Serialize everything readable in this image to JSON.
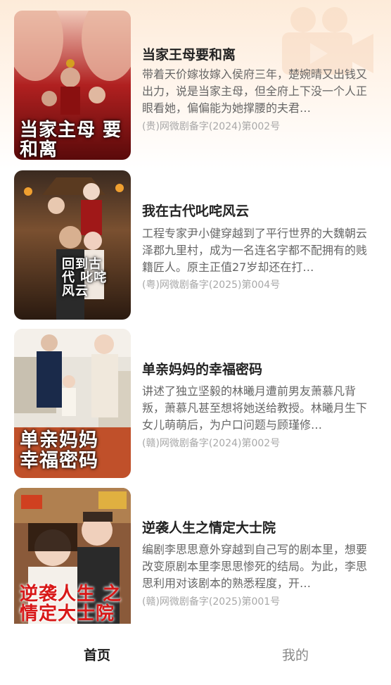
{
  "dramas": [
    {
      "title": "当家王母要和离",
      "description": "带着天价嫁妆嫁入侯府三年，楚婉晴又出钱又出力，说是当家主母，但全府上下没一个人正眼看她，偏偏能为她撑腰的夫君…",
      "registration": "(贵)网微剧备字(2024)第002号",
      "poster_text": "当家主母 要和离"
    },
    {
      "title": "我在古代叱咤风云",
      "description": "工程专家尹小健穿越到了平行世界的大魏朝云泽郡九里村，成为一名连名字都不配拥有的贱籍匠人。原主正值27岁却还在打…",
      "registration": "(粤)网微剧备字(2025)第004号",
      "poster_text": "回到古代 叱咤风云"
    },
    {
      "title": "单亲妈妈的幸福密码",
      "description": "讲述了独立坚毅的林曦月遭前男友萧慕凡背叛，萧慕凡甚至想将她送给教授。林曦月生下女儿萌萌后，为户口问题与顾瑾修…",
      "registration": "(赣)网微剧备字(2024)第002号",
      "poster_text": "单亲妈妈 幸福密码"
    },
    {
      "title": "逆袭人生之情定大士院",
      "description": "编剧李思思意外穿越到自己写的剧本里，想要改变原剧本里李思思惨死的结局。为此，李思思利用对该剧本的熟悉程度，开…",
      "registration": "(赣)网微剧备字(2025)第001号",
      "poster_text": "逆袭人生 之情定大士院"
    }
  ],
  "tabs": {
    "home": "首页",
    "mine": "我的"
  }
}
